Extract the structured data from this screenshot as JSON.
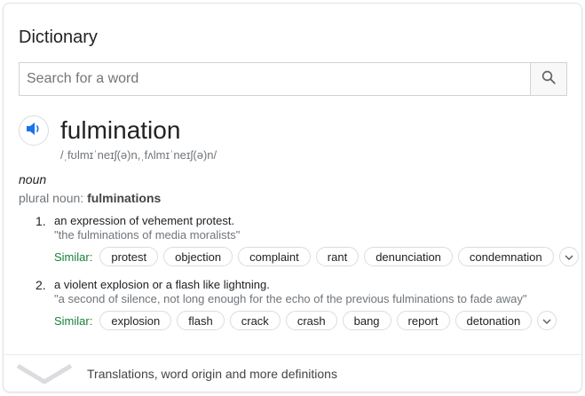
{
  "card": {
    "title": "Dictionary",
    "search": {
      "placeholder": "Search for a word",
      "value": ""
    },
    "icons": {
      "search": "search-icon",
      "audio": "speaker-icon",
      "expand": "chevron-down-icon"
    },
    "entry": {
      "word": "fulmination",
      "phonetic": "/ˌfʊlmɪˈneɪʃ(ə)n,ˌfʌlmɪˈneɪʃ(ə)n/",
      "part_of_speech": "noun",
      "plural_label": "plural noun:",
      "plural_value": "fulminations",
      "senses": [
        {
          "number": "1.",
          "definition": "an expression of vehement protest.",
          "example": "\"the fulminations of media moralists\"",
          "similar_label": "Similar:",
          "similar": [
            "protest",
            "objection",
            "complaint",
            "rant",
            "denunciation",
            "condemnation"
          ]
        },
        {
          "number": "2.",
          "definition": "a violent explosion or a flash like lightning.",
          "example": "\"a second of silence, not long enough for the echo of the previous fulminations to fade away\"",
          "similar_label": "Similar:",
          "similar": [
            "explosion",
            "flash",
            "crack",
            "crash",
            "bang",
            "report",
            "detonation"
          ]
        }
      ]
    },
    "footer": {
      "text": "Translations, word origin and more definitions"
    }
  },
  "colors": {
    "similar_label": "#188038",
    "speaker": "#1a73e8",
    "secondary_text": "#70757a"
  }
}
